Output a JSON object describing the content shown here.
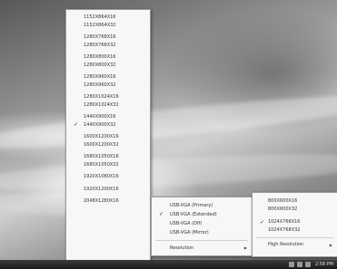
{
  "resolution_menu": {
    "items": [
      {
        "label": "1152X864X16",
        "checked": false
      },
      {
        "label": "1152X864X32",
        "checked": false
      },
      {
        "label": "1280X768X16",
        "checked": false
      },
      {
        "label": "1280X768X32",
        "checked": false
      },
      {
        "label": "1280X800X16",
        "checked": false
      },
      {
        "label": "1280X800X32",
        "checked": false
      },
      {
        "label": "1280X960X16",
        "checked": false
      },
      {
        "label": "1280X960X32",
        "checked": false
      },
      {
        "label": "1280X1024X16",
        "checked": false
      },
      {
        "label": "1280X1024X32",
        "checked": false
      },
      {
        "label": "1440X900X16",
        "checked": false
      },
      {
        "label": "1440X900X32",
        "checked": true
      },
      {
        "label": "1600X1200X16",
        "checked": false
      },
      {
        "label": "1600X1200X32",
        "checked": false
      },
      {
        "label": "1680X1050X16",
        "checked": false
      },
      {
        "label": "1680X1050X32",
        "checked": false
      },
      {
        "label": "1920X1080X16",
        "checked": false
      },
      {
        "label": "1920X1200X16",
        "checked": false
      },
      {
        "label": "2048X1280X16",
        "checked": false
      }
    ]
  },
  "usb_menu": {
    "items": [
      {
        "label": "USB-VGA (Primary)",
        "checked": false
      },
      {
        "label": "USB-VGA (Extended)",
        "checked": true
      },
      {
        "label": "USB-VGA (Off)",
        "checked": false
      },
      {
        "label": "USB-VGA (Mirror)",
        "checked": false
      }
    ],
    "resolution_label": "Resolution"
  },
  "sub_menu": {
    "items": [
      {
        "label": "800X600X16",
        "checked": false
      },
      {
        "label": "800X600X32",
        "checked": false
      },
      {
        "label": "1024X768X16",
        "checked": true
      },
      {
        "label": "1024X768X32",
        "checked": false
      }
    ],
    "high_res_label": "High Resolution"
  },
  "taskbar": {
    "clock": "2:58 PM"
  },
  "check_glyph": "✓",
  "arrow_glyph": "▶"
}
